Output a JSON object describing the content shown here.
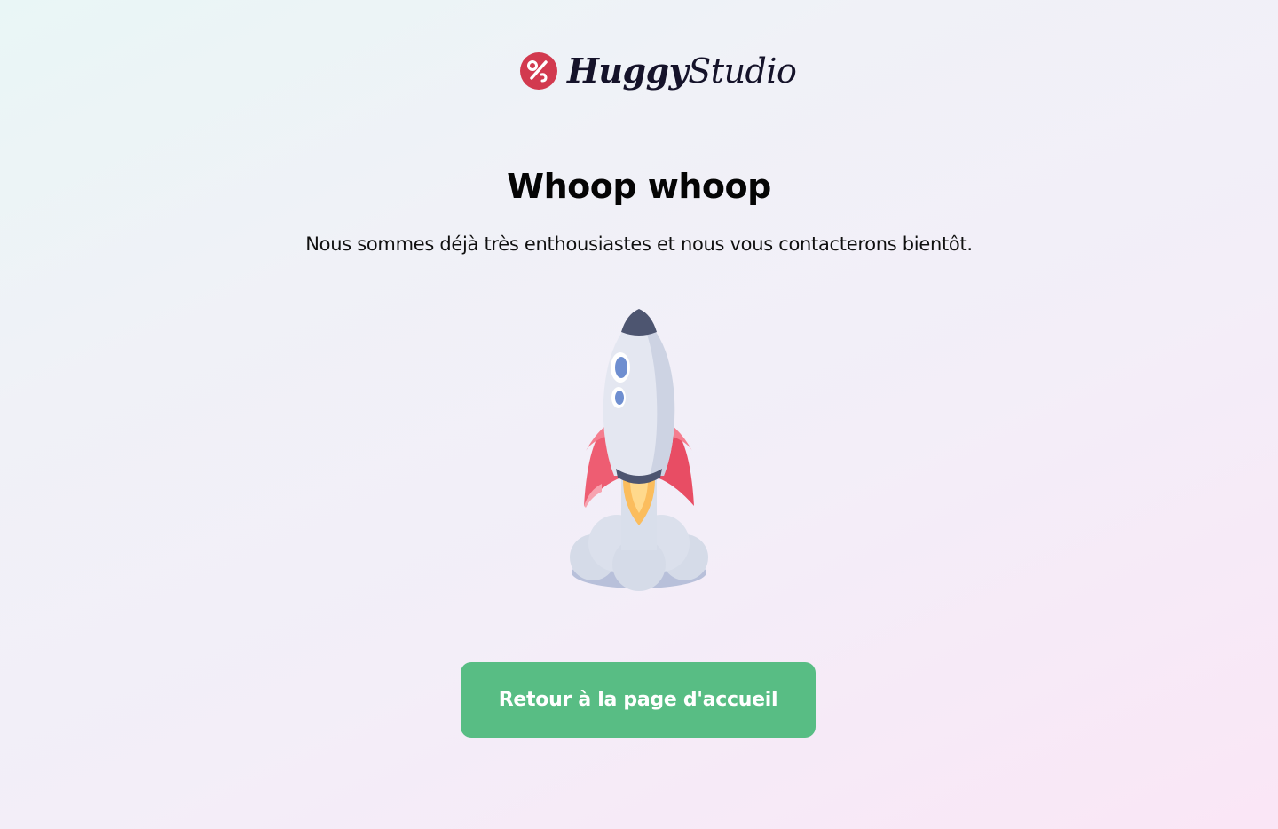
{
  "brand": {
    "name_bold": "Huggy",
    "name_light": "Studio",
    "logo_icon": "huggystudio-logo-icon",
    "accent_color": "#d23a4f"
  },
  "main": {
    "headline": "Whoop whoop",
    "subtitle": "Nous sommes déjà très enthousiastes et nous vous contacterons bientôt.",
    "illustration_icon": "rocket-icon"
  },
  "actions": {
    "home_button_label": "Retour à la page d'accueil",
    "home_button_color": "#58bd84"
  }
}
